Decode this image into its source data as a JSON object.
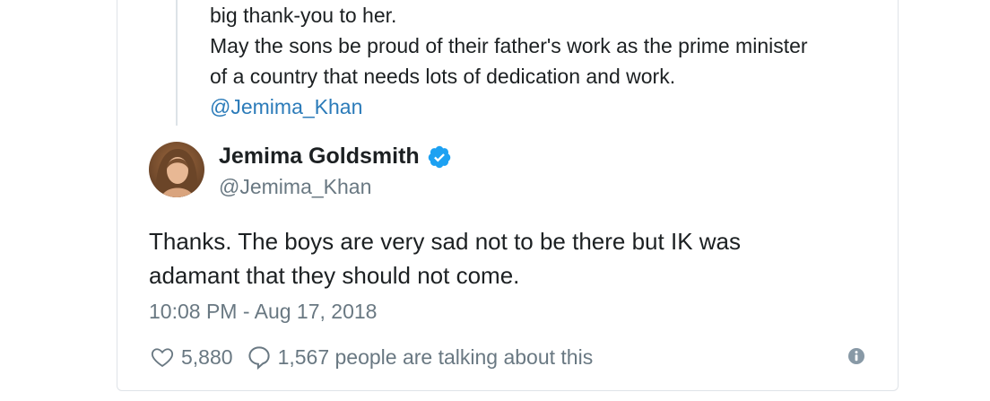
{
  "quoted_tweet": {
    "lines": [
      "big thank-you to her.",
      "May the sons be proud of their father's work as the prime minister",
      "of a country that needs lots of dedication and work."
    ],
    "mention": "@Jemima_Khan"
  },
  "tweet": {
    "author_name": "Jemima Goldsmith",
    "verified": true,
    "handle": "@Jemima_Khan",
    "text_lines": [
      "Thanks. The boys are very sad not to be there but IK was",
      "adamant that they should not come."
    ],
    "timestamp": "10:08 PM - Aug 17, 2018",
    "likes": "5,880",
    "talking": "1,567 people are talking about this"
  },
  "icons": {
    "verified": "verified-badge-icon",
    "like": "heart-icon",
    "reply": "speech-bubble-icon",
    "info": "info-icon"
  },
  "colors": {
    "text": "#1c2022",
    "muted": "#697882",
    "link": "#2b7bb9",
    "verified": "#1da1f2"
  }
}
